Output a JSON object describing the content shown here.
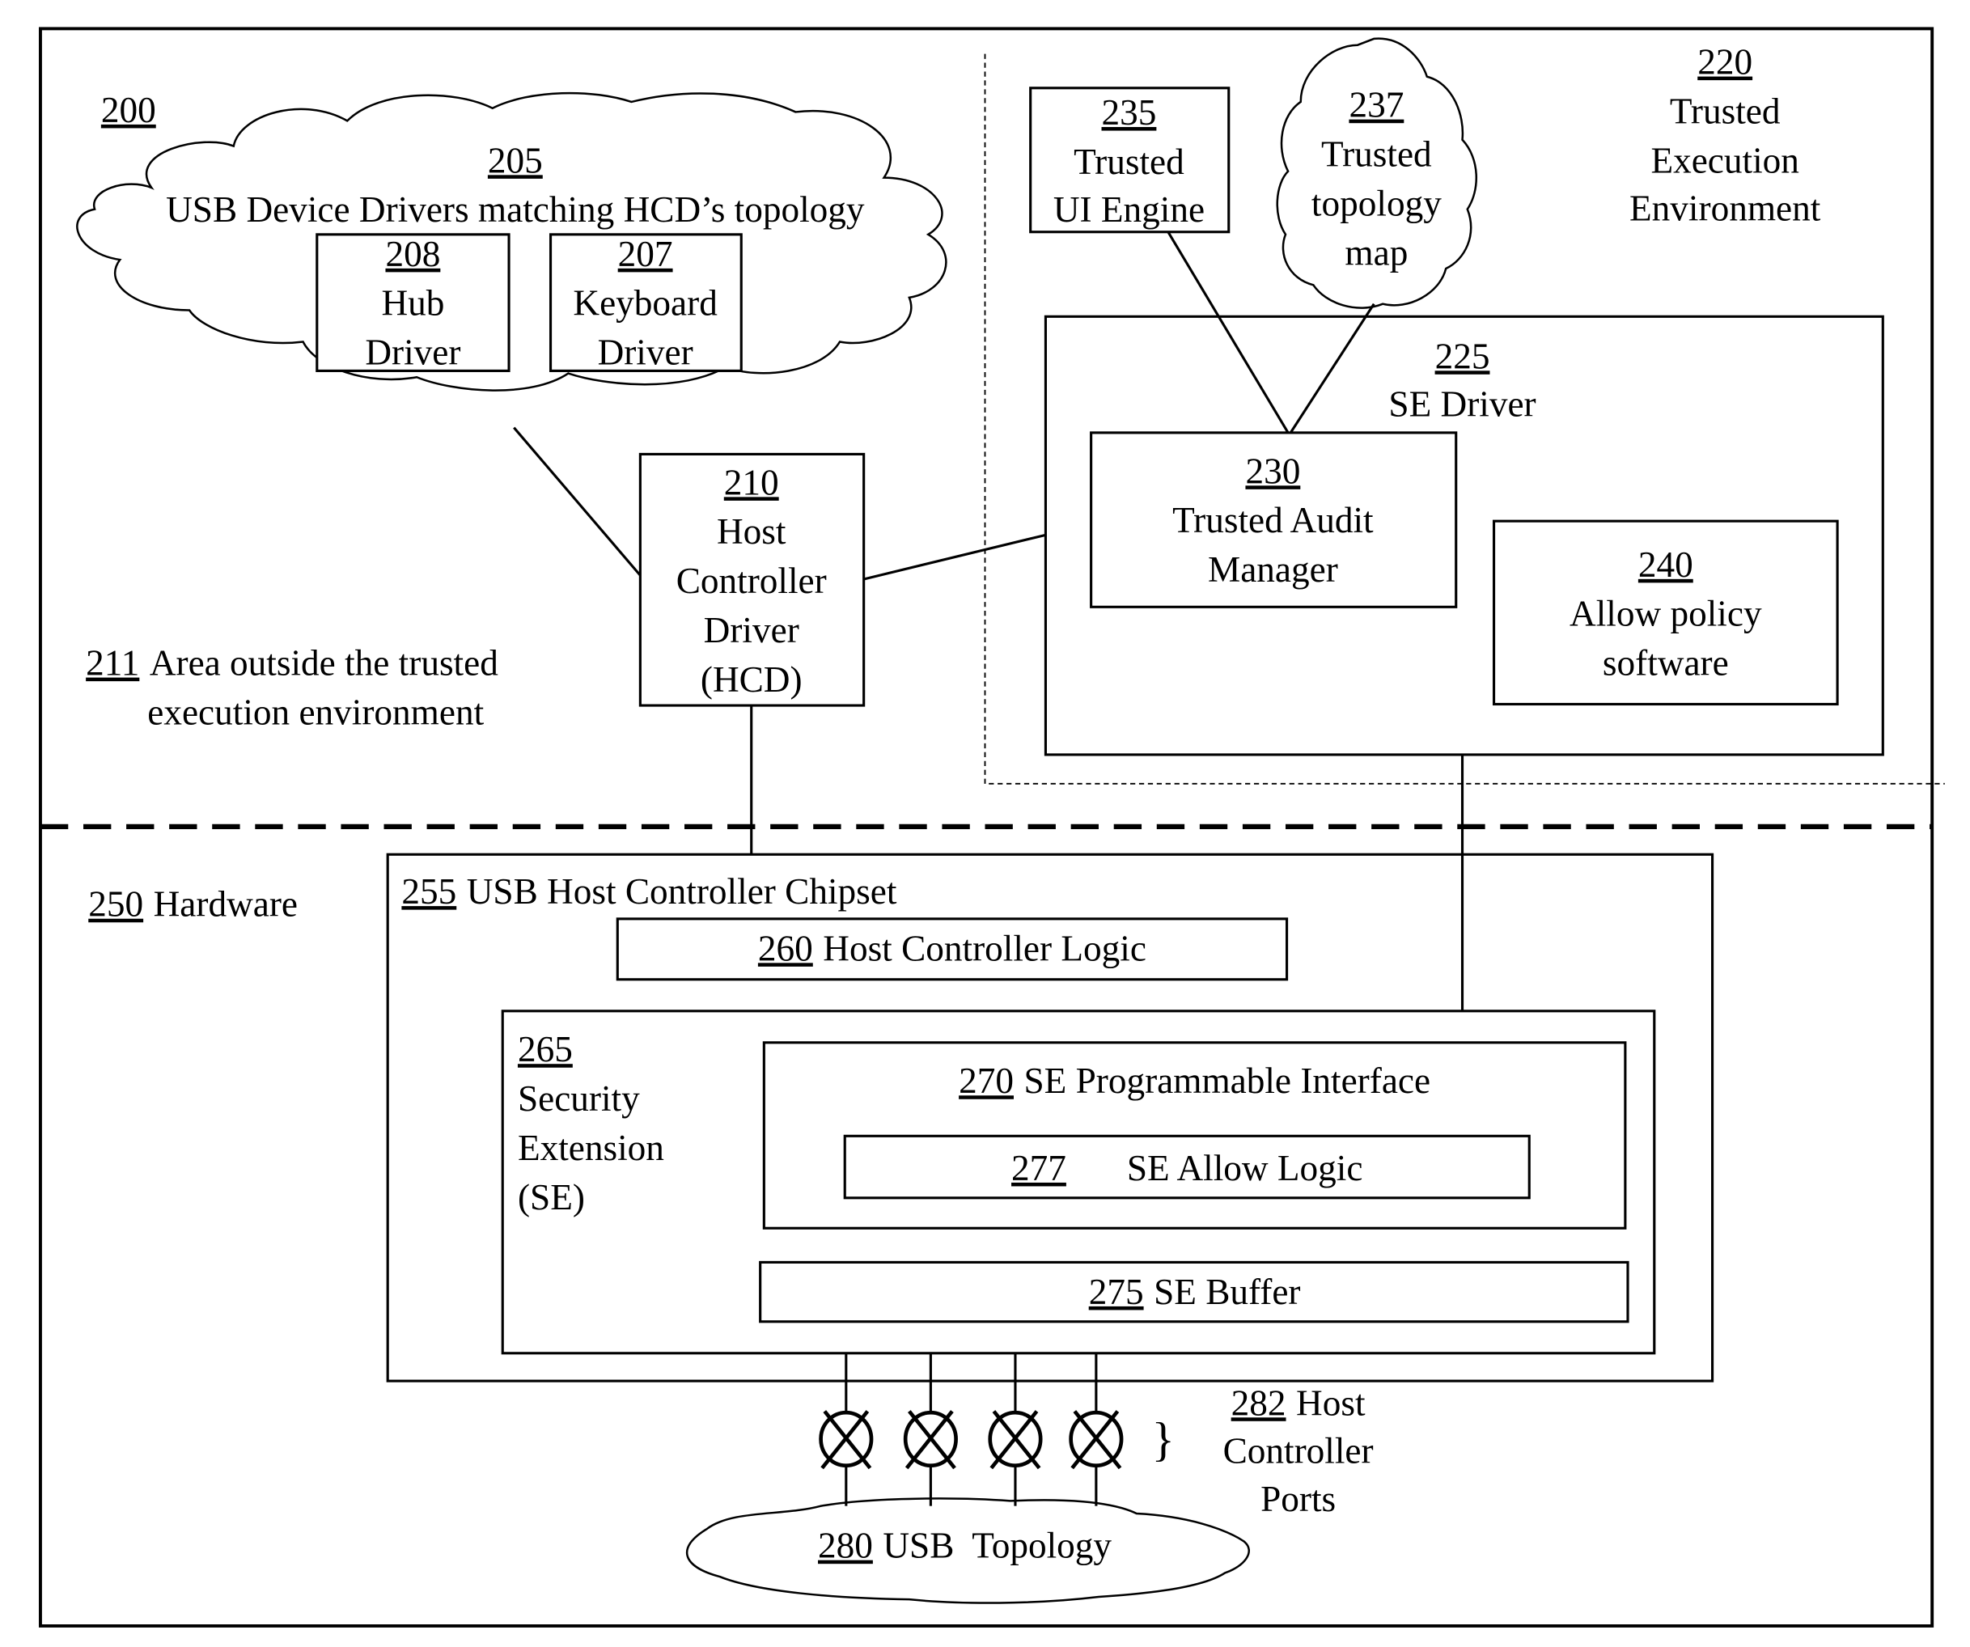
{
  "figure": {
    "ref_main": "200",
    "outside_area": {
      "ref": "211",
      "line1": "Area outside the trusted",
      "line2": "execution environment"
    },
    "hardware": {
      "ref": "250",
      "label": "Hardware"
    },
    "tee": {
      "ref": "220",
      "lines": [
        "Trusted",
        "Execution",
        "Environment"
      ]
    }
  },
  "nodes": {
    "usb_device_drivers": {
      "ref": "205",
      "label": "USB Device Drivers matching HCD’s topology"
    },
    "hub_driver": {
      "ref": "208",
      "lines": [
        "Hub",
        "Driver"
      ]
    },
    "keyboard_driver": {
      "ref": "207",
      "lines": [
        "Keyboard",
        "Driver"
      ]
    },
    "hcd": {
      "ref": "210",
      "lines": [
        "Host",
        "Controller",
        "Driver",
        "(HCD)"
      ]
    },
    "trusted_ui": {
      "ref": "235",
      "lines": [
        "Trusted",
        "UI Engine"
      ]
    },
    "topology_map": {
      "ref": "237",
      "lines": [
        "Trusted",
        "topology",
        "map"
      ]
    },
    "se_driver": {
      "ref": "225",
      "label": "SE Driver"
    },
    "audit_manager": {
      "ref": "230",
      "lines": [
        "Trusted Audit",
        "Manager"
      ]
    },
    "allow_policy": {
      "ref": "240",
      "lines": [
        "Allow policy",
        "software"
      ]
    },
    "chipset": {
      "ref": "255",
      "label": "USB Host Controller Chipset"
    },
    "hc_logic": {
      "ref": "260",
      "label": "Host Controller Logic"
    },
    "security_extension": {
      "ref": "265",
      "lines": [
        "Security",
        "Extension",
        "(SE)"
      ]
    },
    "se_prog_interface": {
      "ref": "270",
      "label": "SE Programmable Interface"
    },
    "se_allow_logic": {
      "ref": "277",
      "label": "SE Allow Logic"
    },
    "se_buffer": {
      "ref": "275",
      "label": "SE Buffer"
    },
    "usb_topology": {
      "ref": "280",
      "label": "USB  Topology"
    },
    "ports": {
      "ref": "282",
      "lines": [
        "Host",
        "Controller",
        "Ports"
      ],
      "count": 4
    }
  }
}
